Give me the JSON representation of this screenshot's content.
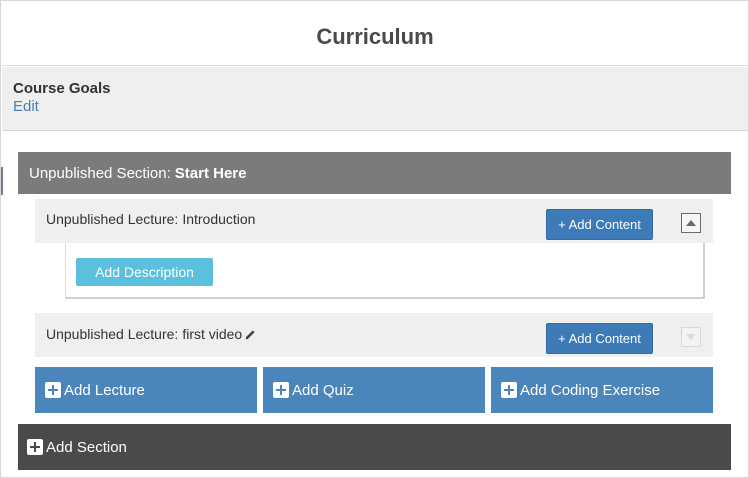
{
  "page": {
    "title": "Curriculum"
  },
  "goals": {
    "title": "Course Goals",
    "edit_label": "Edit"
  },
  "section": {
    "prefix": "Unpublished Section:",
    "name": "Start Here"
  },
  "lectures": [
    {
      "prefix": "Unpublished Lecture:",
      "name": "Introduction",
      "add_content_label": "+ Add Content",
      "toggle_state": "expanded"
    },
    {
      "prefix": "Unpublished Lecture:",
      "name": "first video",
      "add_content_label": "+ Add Content",
      "toggle_state": "collapsed"
    }
  ],
  "lecture_body": {
    "add_description_label": "Add Description"
  },
  "actions": {
    "add_lecture": "Add Lecture",
    "add_quiz": "Add Quiz",
    "add_coding_exercise": "Add Coding Exercise"
  },
  "add_section_label": "Add Section",
  "icons": {
    "pencil": "pencil-icon",
    "plus": "plus-icon",
    "toggle_up": "caret-up-icon",
    "toggle_down": "caret-down-icon"
  },
  "colors": {
    "primary": "#3d7ab8",
    "info": "#5bc0de",
    "section_bg": "#7b7b7b",
    "add_section_bg": "#4a4a4a"
  }
}
